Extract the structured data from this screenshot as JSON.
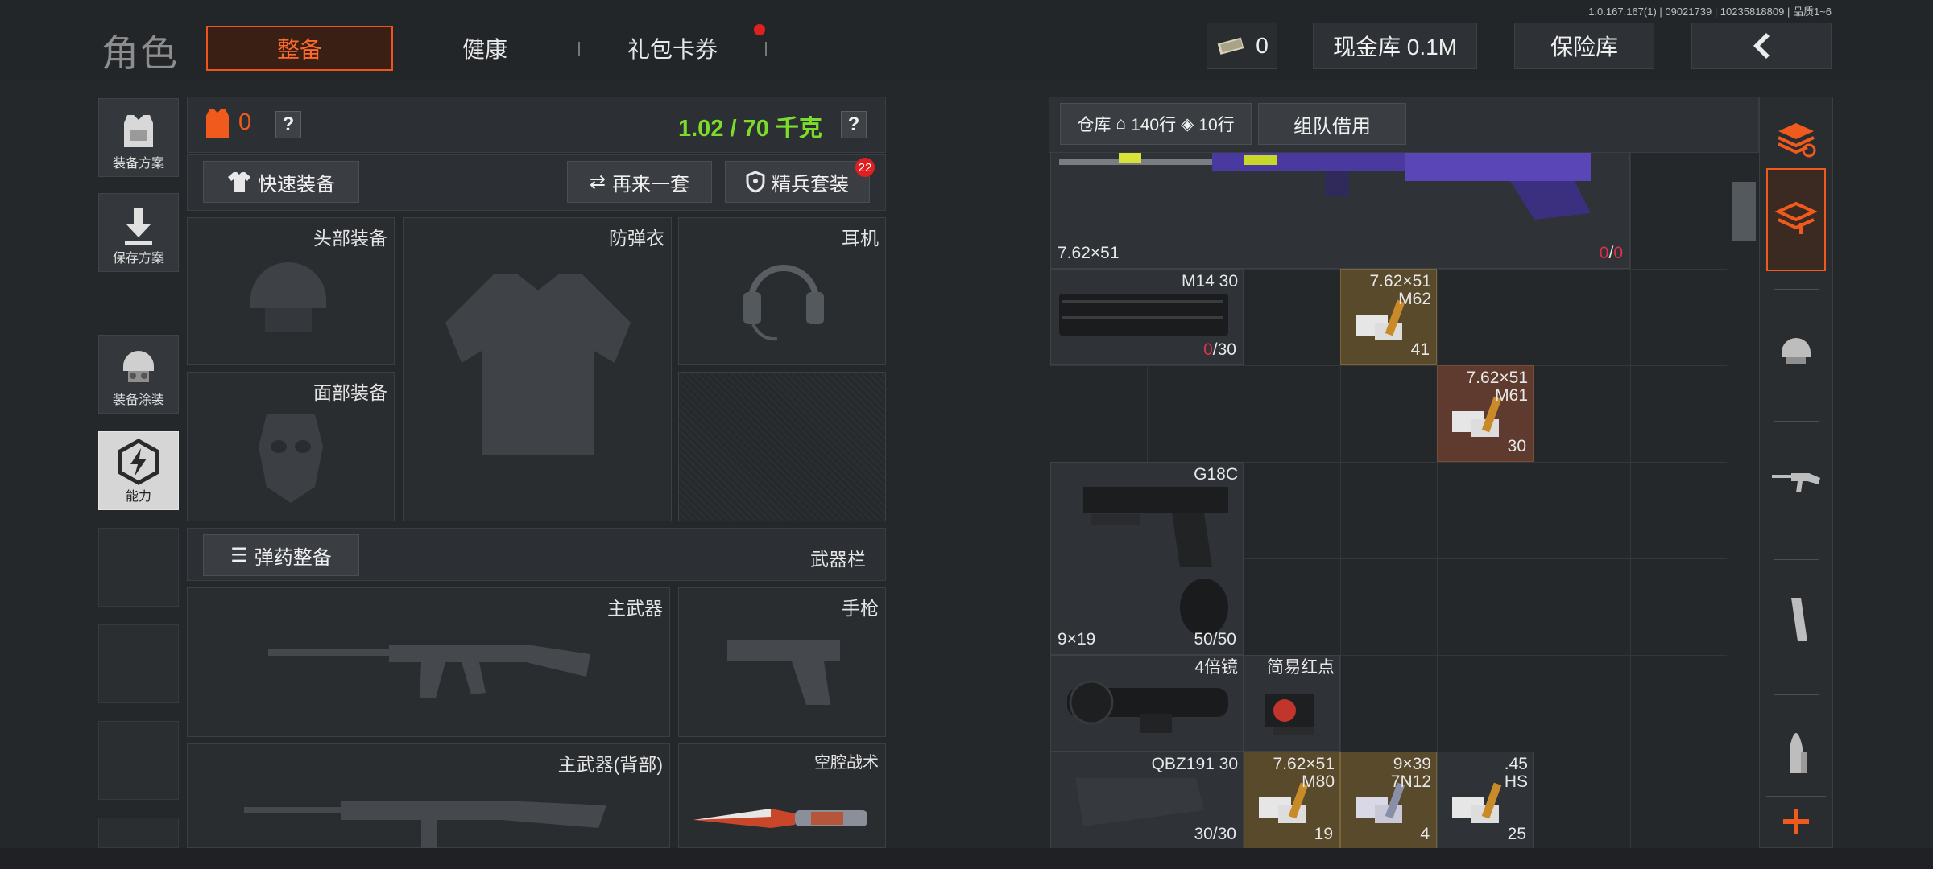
{
  "version": "1.0.167.167(1) | 09021739 | 10235818809 | 品质1~6",
  "title": "角色",
  "tabs": [
    {
      "label": "整备",
      "active": true
    },
    {
      "label": "健康",
      "active": false
    },
    {
      "label": "礼包卡券",
      "active": false,
      "has_notification": true
    }
  ],
  "top_right": {
    "cash_count": "0",
    "vault_label": "现金库 0.1M",
    "safe_label": "保险库",
    "back_icon": "chevron-left-icon"
  },
  "left_rail": [
    {
      "label": "装备方案",
      "icon": "vest-icon"
    },
    {
      "label": "保存方案",
      "icon": "download-icon"
    },
    {
      "label": "装备涂装",
      "icon": "helmet-icon"
    },
    {
      "label": "能力",
      "icon": "energy-icon"
    }
  ],
  "loadout": {
    "armor_count": "0",
    "help": "?",
    "weight": "1.02 / 70 千克",
    "quick_equip": "快速装备",
    "again": "再来一套",
    "elite": "精兵套装",
    "elite_badge": "22",
    "slots": {
      "head": "头部装备",
      "armor": "防弹衣",
      "headset": "耳机",
      "face": "面部装备"
    },
    "ammo_equip": "弹药整备",
    "weapon_bar": "武器栏",
    "weapons": {
      "primary": "主武器",
      "pistol": "手枪",
      "primary_back": "主武器(背部)",
      "melee": "空腔战术"
    }
  },
  "stash": {
    "warehouse": "仓库",
    "rows1": "140行",
    "rows2": "10行",
    "team_borrow": "组队借用",
    "items": {
      "rifle_caliber": "7.62×51",
      "rifle_ammo_cur": "0",
      "rifle_ammo_sep": "/",
      "rifle_ammo_max": "0",
      "mag1_name": "M14 30",
      "mag1_cur": "0",
      "mag1_max": "/30",
      "ammo1_name": "7.62×51",
      "ammo1_sub": "M62",
      "ammo1_count": "41",
      "ammo2_name": "7.62×51",
      "ammo2_sub": "M61",
      "ammo2_count": "30",
      "pistol_name": "G18C",
      "pistol_caliber": "9×19",
      "pistol_ammo": "50/50",
      "scope_name": "4倍镜",
      "reddot_name": "简易红点",
      "mag2_name": "QBZ191 30",
      "mag2_count": "30/30",
      "ammo3_name": "7.62×51",
      "ammo3_sub": "M80",
      "ammo3_count": "19",
      "ammo4_name": "9×39",
      "ammo4_sub": "7N12",
      "ammo4_count": "4",
      "ammo5_name": ".45",
      "ammo5_sub": "HS",
      "ammo5_count": "25"
    }
  },
  "right_rail": [
    "sort-icon",
    "storage-icon",
    "helmet-icon",
    "rifle-icon",
    "magazine-icon",
    "bullet-icon",
    "plus-icon"
  ],
  "colors": {
    "accent": "#f0531b",
    "weight": "#7cdc2c",
    "badge": "#e02020"
  }
}
